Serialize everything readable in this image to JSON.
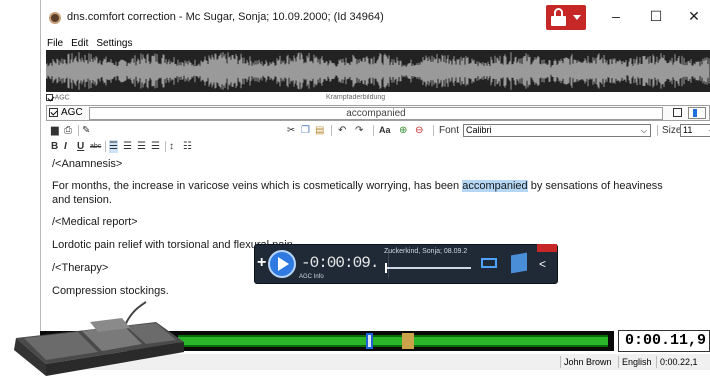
{
  "window": {
    "title": "dns.comfort correction - Mc Sugar, Sonja; 10.09.2000; (Id 34964)",
    "minimize": "–",
    "maximize": "☐",
    "close": "✕"
  },
  "menu": [
    "File",
    "Edit",
    "Settings"
  ],
  "agc": {
    "label": "AGC",
    "hidden_row_text": "Krampfaderbildung",
    "current_word": "accompanied"
  },
  "toolbar": {
    "font_label": "Font",
    "font_value": "Calibri",
    "size_label": "Size",
    "size_value": "11",
    "bold": "B",
    "italic": "I",
    "underline": "U",
    "strike": "abc"
  },
  "document": {
    "line1": "/<Anamnesis>",
    "line2_before": "For months, the increase in varicose veins which is cosmetically worrying, has been ",
    "line2_highlight": "accompanied",
    "line2_after": " by sensations of heaviness",
    "line3": "and tension.",
    "line4": "/<Medical report>",
    "line5": "Lordotic pain relief with torsional and flexural pain.",
    "line6": "/<Therapy>",
    "line7": "Compression stockings."
  },
  "player": {
    "time": "-0:00:09.",
    "info": "Zuckerkind, Sonja; 08.09.2",
    "sub_labels": "AGC  Info"
  },
  "timeline": {
    "current_time": "0:00.11,9"
  },
  "status": {
    "user": "John Brown",
    "language": "English",
    "duration": "0:00.22,1"
  },
  "colors": {
    "accent_red": "#c62828",
    "highlight": "#b5d7f5",
    "timeline_green": "#2bb52b",
    "player_bg": "#1f2a36"
  }
}
